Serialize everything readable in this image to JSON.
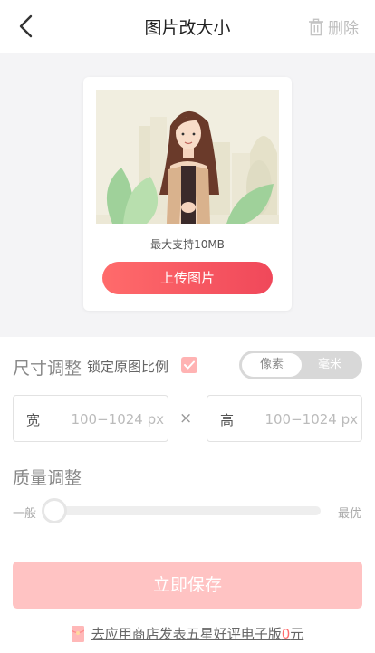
{
  "header": {
    "title": "图片改大小",
    "delete_label": "删除",
    "back_icon": "chevron-left-icon",
    "delete_icon": "trash-icon"
  },
  "preview": {
    "hint": "最大支持10MB",
    "upload_label": "上传图片"
  },
  "size": {
    "label": "尺寸调整",
    "lock_label": "锁定原图比例",
    "lock_checked": true,
    "units": [
      "像素",
      "毫米"
    ],
    "selected_unit": "像素",
    "width_label": "宽",
    "width_placeholder": "100−1024 px",
    "height_label": "高",
    "height_placeholder": "100−1024 px",
    "times": "×"
  },
  "quality": {
    "label": "质量调整",
    "low_label": "一般",
    "high_label": "最优",
    "value": 0
  },
  "save_label": "立即保存",
  "promo": {
    "text": "去应用商店发表五星好评电子版",
    "accent": "0",
    "suffix": "元"
  },
  "colors": {
    "accent": "#f0485a",
    "save_disabled": "#ffc3c3",
    "background": "#f4f4f6"
  }
}
